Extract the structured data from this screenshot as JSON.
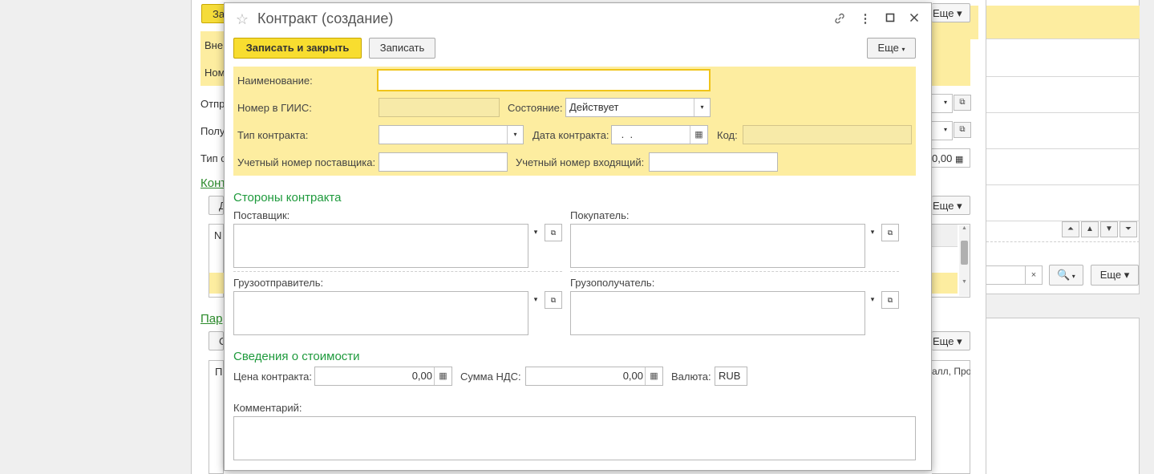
{
  "background": {
    "button_partial": "За",
    "panel_line1": "Вне",
    "panel_line2": "Ном",
    "label_sender": "Отпр",
    "label_receiver": "Полу",
    "label_type": "Тип с",
    "link_contracts": "Конт",
    "link_params": "Пар",
    "btn_partial_1": "Д",
    "btn_partial_2": "С",
    "col_n": "N",
    "col_p": "П",
    "more_label": "Еще",
    "amount": "0,00",
    "col_right_text": "алл, Про"
  },
  "right_panel": {
    "more_label": "Еще"
  },
  "modal": {
    "title": "Контракт (создание)",
    "toolbar": {
      "save_close": "Записать и закрыть",
      "save": "Записать",
      "more": "Еще"
    },
    "fields": {
      "name_label": "Наименование:",
      "name_value": "",
      "giis_label": "Номер в ГИИС:",
      "giis_value": "",
      "state_label": "Состояние:",
      "state_value": "Действует",
      "type_label": "Тип контракта:",
      "type_value": "",
      "date_label": "Дата контракта:",
      "date_value": " .  .",
      "code_label": "Код:",
      "code_value": "",
      "supplier_acc_label": "Учетный номер поставщика:",
      "supplier_acc_value": "",
      "incoming_acc_label": "Учетный номер входящий:",
      "incoming_acc_value": ""
    },
    "parties": {
      "section_title": "Стороны контракта",
      "supplier_label": "Поставщик:",
      "buyer_label": "Покупатель:",
      "shipper_label": "Грузоотправитель:",
      "consignee_label": "Грузополучатель:"
    },
    "cost": {
      "section_title": "Сведения о стоимости",
      "price_label": "Цена контракта:",
      "price_value": "0,00",
      "vat_label": "Сумма НДС:",
      "vat_value": "0,00",
      "currency_label": "Валюта:",
      "currency_value": "RUB"
    },
    "comment_label": "Комментарий:",
    "comment_value": ""
  }
}
